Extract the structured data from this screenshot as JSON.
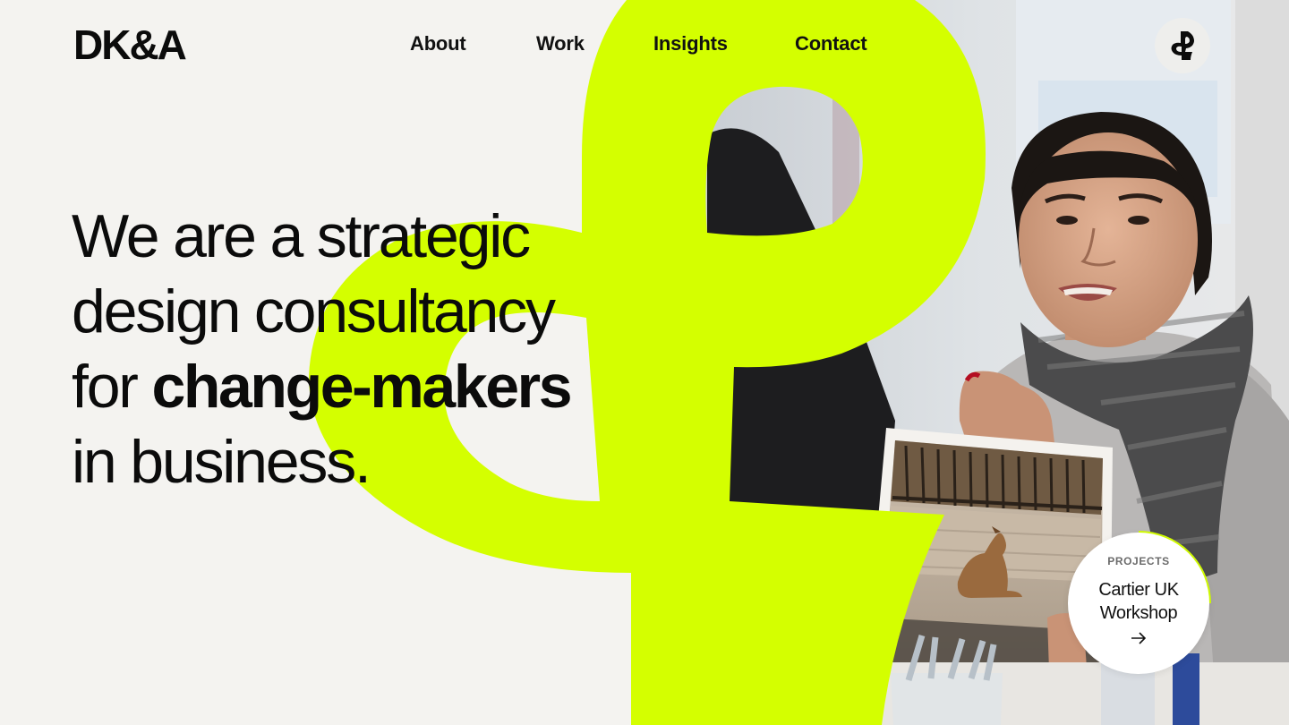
{
  "brand": {
    "logo_text": "DK&A",
    "accent_color": "#d4ff00"
  },
  "nav": {
    "items": [
      {
        "label": "About"
      },
      {
        "label": "Work"
      },
      {
        "label": "Insights"
      },
      {
        "label": "Contact"
      }
    ],
    "corner_icon": "ampersand-icon"
  },
  "hero": {
    "line1": "We are a strategic",
    "line2": "design consultancy",
    "line3_prefix": "for ",
    "line3_bold": "change-makers",
    "line4": "in business."
  },
  "project_card": {
    "tag": "PROJECTS",
    "title": "Cartier UK Workshop",
    "icon": "arrow-right-icon"
  },
  "photo": {
    "subject": "woman in scarf holding photograph",
    "held_photo_subject": "fox by brick wall"
  }
}
